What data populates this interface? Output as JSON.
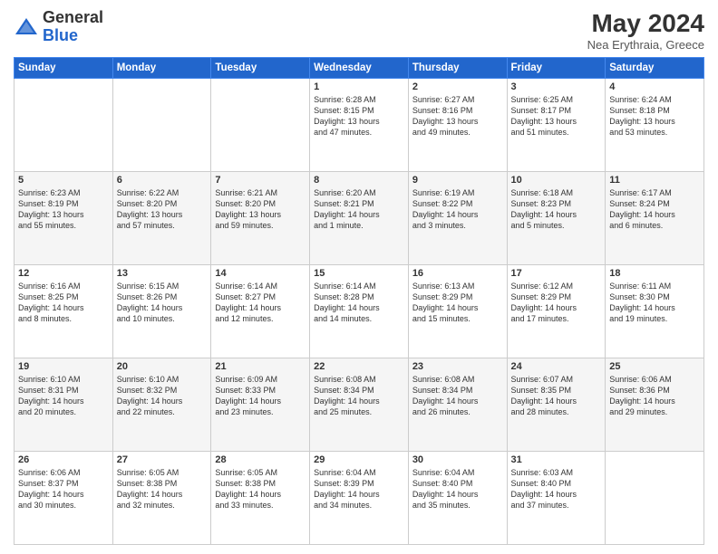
{
  "header": {
    "logo_general": "General",
    "logo_blue": "Blue",
    "month_title": "May 2024",
    "subtitle": "Nea Erythraia, Greece"
  },
  "weekdays": [
    "Sunday",
    "Monday",
    "Tuesday",
    "Wednesday",
    "Thursday",
    "Friday",
    "Saturday"
  ],
  "weeks": [
    [
      {
        "day": "",
        "info": ""
      },
      {
        "day": "",
        "info": ""
      },
      {
        "day": "",
        "info": ""
      },
      {
        "day": "1",
        "info": "Sunrise: 6:28 AM\nSunset: 8:15 PM\nDaylight: 13 hours\nand 47 minutes."
      },
      {
        "day": "2",
        "info": "Sunrise: 6:27 AM\nSunset: 8:16 PM\nDaylight: 13 hours\nand 49 minutes."
      },
      {
        "day": "3",
        "info": "Sunrise: 6:25 AM\nSunset: 8:17 PM\nDaylight: 13 hours\nand 51 minutes."
      },
      {
        "day": "4",
        "info": "Sunrise: 6:24 AM\nSunset: 8:18 PM\nDaylight: 13 hours\nand 53 minutes."
      }
    ],
    [
      {
        "day": "5",
        "info": "Sunrise: 6:23 AM\nSunset: 8:19 PM\nDaylight: 13 hours\nand 55 minutes."
      },
      {
        "day": "6",
        "info": "Sunrise: 6:22 AM\nSunset: 8:20 PM\nDaylight: 13 hours\nand 57 minutes."
      },
      {
        "day": "7",
        "info": "Sunrise: 6:21 AM\nSunset: 8:20 PM\nDaylight: 13 hours\nand 59 minutes."
      },
      {
        "day": "8",
        "info": "Sunrise: 6:20 AM\nSunset: 8:21 PM\nDaylight: 14 hours\nand 1 minute."
      },
      {
        "day": "9",
        "info": "Sunrise: 6:19 AM\nSunset: 8:22 PM\nDaylight: 14 hours\nand 3 minutes."
      },
      {
        "day": "10",
        "info": "Sunrise: 6:18 AM\nSunset: 8:23 PM\nDaylight: 14 hours\nand 5 minutes."
      },
      {
        "day": "11",
        "info": "Sunrise: 6:17 AM\nSunset: 8:24 PM\nDaylight: 14 hours\nand 6 minutes."
      }
    ],
    [
      {
        "day": "12",
        "info": "Sunrise: 6:16 AM\nSunset: 8:25 PM\nDaylight: 14 hours\nand 8 minutes."
      },
      {
        "day": "13",
        "info": "Sunrise: 6:15 AM\nSunset: 8:26 PM\nDaylight: 14 hours\nand 10 minutes."
      },
      {
        "day": "14",
        "info": "Sunrise: 6:14 AM\nSunset: 8:27 PM\nDaylight: 14 hours\nand 12 minutes."
      },
      {
        "day": "15",
        "info": "Sunrise: 6:14 AM\nSunset: 8:28 PM\nDaylight: 14 hours\nand 14 minutes."
      },
      {
        "day": "16",
        "info": "Sunrise: 6:13 AM\nSunset: 8:29 PM\nDaylight: 14 hours\nand 15 minutes."
      },
      {
        "day": "17",
        "info": "Sunrise: 6:12 AM\nSunset: 8:29 PM\nDaylight: 14 hours\nand 17 minutes."
      },
      {
        "day": "18",
        "info": "Sunrise: 6:11 AM\nSunset: 8:30 PM\nDaylight: 14 hours\nand 19 minutes."
      }
    ],
    [
      {
        "day": "19",
        "info": "Sunrise: 6:10 AM\nSunset: 8:31 PM\nDaylight: 14 hours\nand 20 minutes."
      },
      {
        "day": "20",
        "info": "Sunrise: 6:10 AM\nSunset: 8:32 PM\nDaylight: 14 hours\nand 22 minutes."
      },
      {
        "day": "21",
        "info": "Sunrise: 6:09 AM\nSunset: 8:33 PM\nDaylight: 14 hours\nand 23 minutes."
      },
      {
        "day": "22",
        "info": "Sunrise: 6:08 AM\nSunset: 8:34 PM\nDaylight: 14 hours\nand 25 minutes."
      },
      {
        "day": "23",
        "info": "Sunrise: 6:08 AM\nSunset: 8:34 PM\nDaylight: 14 hours\nand 26 minutes."
      },
      {
        "day": "24",
        "info": "Sunrise: 6:07 AM\nSunset: 8:35 PM\nDaylight: 14 hours\nand 28 minutes."
      },
      {
        "day": "25",
        "info": "Sunrise: 6:06 AM\nSunset: 8:36 PM\nDaylight: 14 hours\nand 29 minutes."
      }
    ],
    [
      {
        "day": "26",
        "info": "Sunrise: 6:06 AM\nSunset: 8:37 PM\nDaylight: 14 hours\nand 30 minutes."
      },
      {
        "day": "27",
        "info": "Sunrise: 6:05 AM\nSunset: 8:38 PM\nDaylight: 14 hours\nand 32 minutes."
      },
      {
        "day": "28",
        "info": "Sunrise: 6:05 AM\nSunset: 8:38 PM\nDaylight: 14 hours\nand 33 minutes."
      },
      {
        "day": "29",
        "info": "Sunrise: 6:04 AM\nSunset: 8:39 PM\nDaylight: 14 hours\nand 34 minutes."
      },
      {
        "day": "30",
        "info": "Sunrise: 6:04 AM\nSunset: 8:40 PM\nDaylight: 14 hours\nand 35 minutes."
      },
      {
        "day": "31",
        "info": "Sunrise: 6:03 AM\nSunset: 8:40 PM\nDaylight: 14 hours\nand 37 minutes."
      },
      {
        "day": "",
        "info": ""
      }
    ]
  ]
}
